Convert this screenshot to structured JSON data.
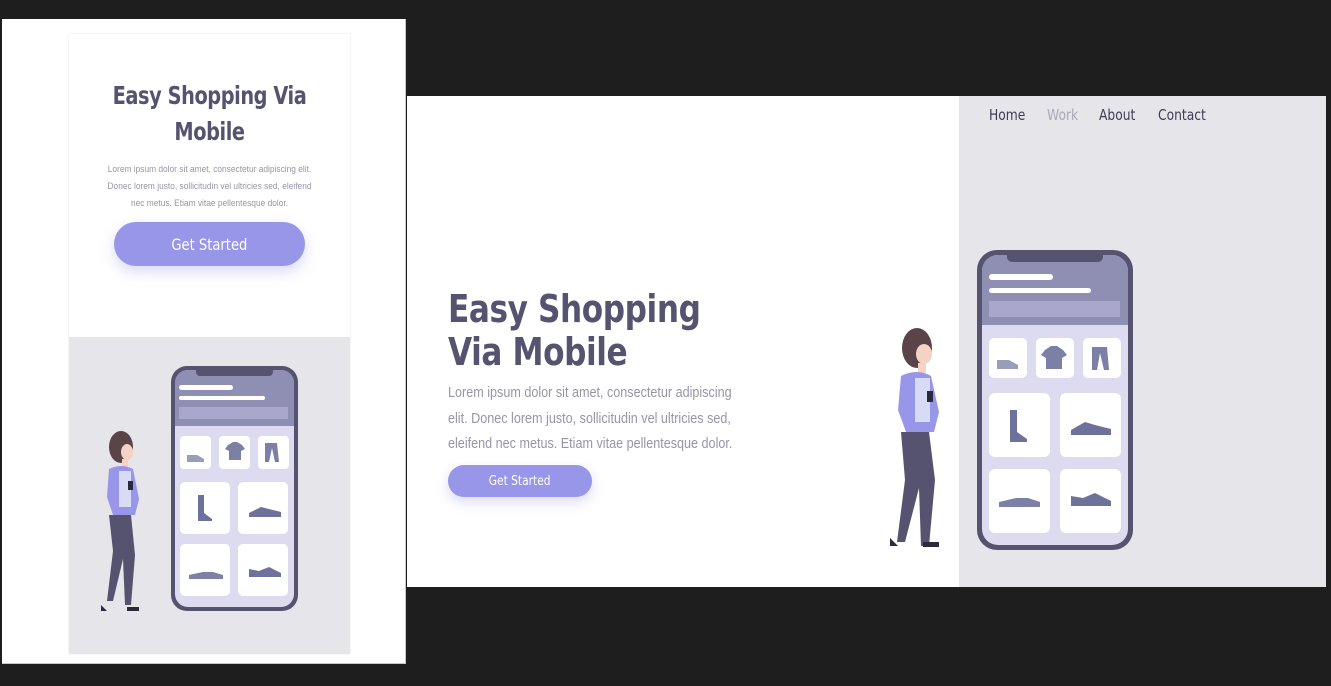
{
  "hero": {
    "title": "Easy Shopping Via Mobile",
    "title_line1": "Easy Shopping",
    "title_line2": "Via Mobile",
    "description": "Lorem ipsum dolor sit amet, consectetur adipiscing elit. Donec lorem justo, sollicitudin vel ultricies sed, eleifend nec metus. Etiam vitae pellentesque dolor.",
    "cta_label": "Get Started"
  },
  "nav": {
    "items": [
      {
        "label": "Home",
        "active": false
      },
      {
        "label": "Work",
        "active": true
      },
      {
        "label": "About",
        "active": false
      },
      {
        "label": "Contact",
        "active": false
      }
    ]
  },
  "illustration": {
    "phone_tiles": [
      "sneaker-icon",
      "tshirt-icon",
      "pants-icon",
      "boot-icon",
      "shoe-icon",
      "flat-shoe-icon",
      "running-shoe-icon"
    ]
  },
  "colors": {
    "accent": "#9896e8",
    "heading": "#55536f",
    "body_text": "#9795a6",
    "panel_bg": "#e6e5ea",
    "phone_frame": "#55536f"
  }
}
